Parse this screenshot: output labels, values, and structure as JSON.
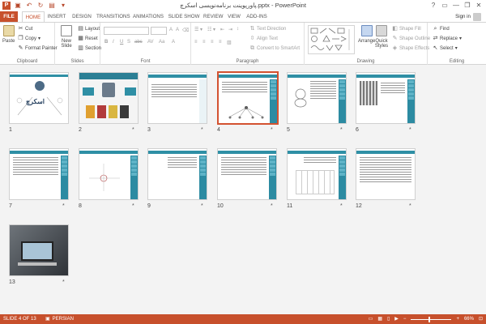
{
  "window": {
    "title": "پاورپوینت برنامه‌نویسی اسکرچ.pptx - PowerPoint",
    "minimize": "—",
    "restore": "❐",
    "close": "✕",
    "help": "?"
  },
  "tabs": [
    "FILE",
    "HOME",
    "INSERT",
    "DESIGN",
    "TRANSITIONS",
    "ANIMATIONS",
    "SLIDE SHOW",
    "REVIEW",
    "VIEW",
    "ADD-INS"
  ],
  "user": {
    "label": "Sign in"
  },
  "ribbon": {
    "clipboard": {
      "label": "Clipboard",
      "paste": "Paste",
      "cut": "Cut",
      "copy": "Copy",
      "format_painter": "Format Painter"
    },
    "slides": {
      "label": "Slides",
      "new_slide": "New Slide",
      "layout": "Layout",
      "reset": "Reset",
      "section": "Section"
    },
    "font": {
      "label": "Font"
    },
    "paragraph": {
      "label": "Paragraph",
      "text_direction": "Text Direction",
      "align_text": "Align Text",
      "convert_smartart": "Convert to SmartArt"
    },
    "drawing": {
      "label": "Drawing",
      "arrange": "Arrange",
      "quick_styles": "Quick Styles",
      "shape_fill": "Shape Fill",
      "shape_outline": "Shape Outline",
      "shape_effects": "Shape Effects"
    },
    "editing": {
      "label": "Editing",
      "find": "Find",
      "replace": "Replace",
      "select": "Select"
    }
  },
  "slides": [
    {
      "num": "1"
    },
    {
      "num": "2"
    },
    {
      "num": "3"
    },
    {
      "num": "4"
    },
    {
      "num": "5"
    },
    {
      "num": "6"
    },
    {
      "num": "7"
    },
    {
      "num": "8"
    },
    {
      "num": "9"
    },
    {
      "num": "10"
    },
    {
      "num": "11"
    },
    {
      "num": "12"
    },
    {
      "num": "13"
    }
  ],
  "slide1_title": "اسکرچ",
  "star": "*",
  "status": {
    "slide": "SLIDE 4 OF 13",
    "language": "PERSIAN",
    "zoom": "66%"
  },
  "colors": {
    "accent": "#c7502c",
    "teal": "#2f8fa5"
  }
}
